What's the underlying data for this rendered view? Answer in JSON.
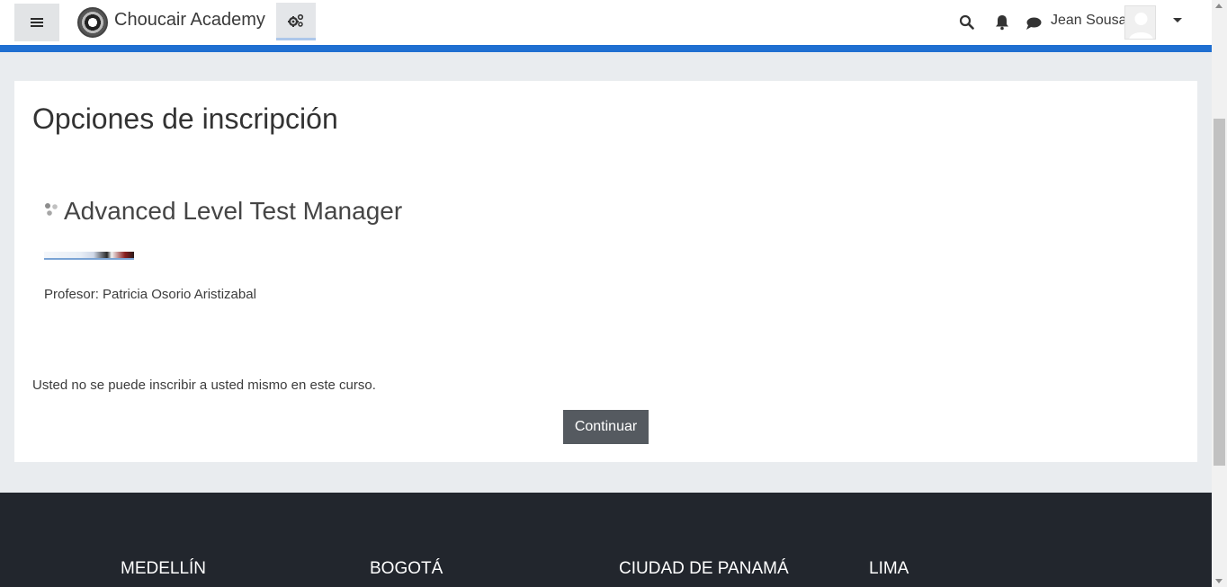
{
  "header": {
    "brand": "Choucair Academy",
    "user_name": "Jean Sousa",
    "icons": [
      "hamburger-icon",
      "logo",
      "settings-icon",
      "search-icon",
      "bell-icon",
      "chat-icon",
      "avatar",
      "caret-down-icon"
    ],
    "accent_color": "#1f6fd1"
  },
  "main": {
    "page_title": "Opciones de inscripción",
    "course": {
      "name": "Advanced Level Test Manager",
      "teacher_label": "Profesor: Patricia Osorio Aristizabal"
    },
    "notice": "Usted no se puede inscribir a usted mismo en este curso.",
    "continue_label": "Continuar"
  },
  "footer": {
    "cities": [
      "MEDELLÍN",
      "BOGOTÁ",
      "CIUDAD DE PANAMÁ",
      "LIMA"
    ]
  }
}
